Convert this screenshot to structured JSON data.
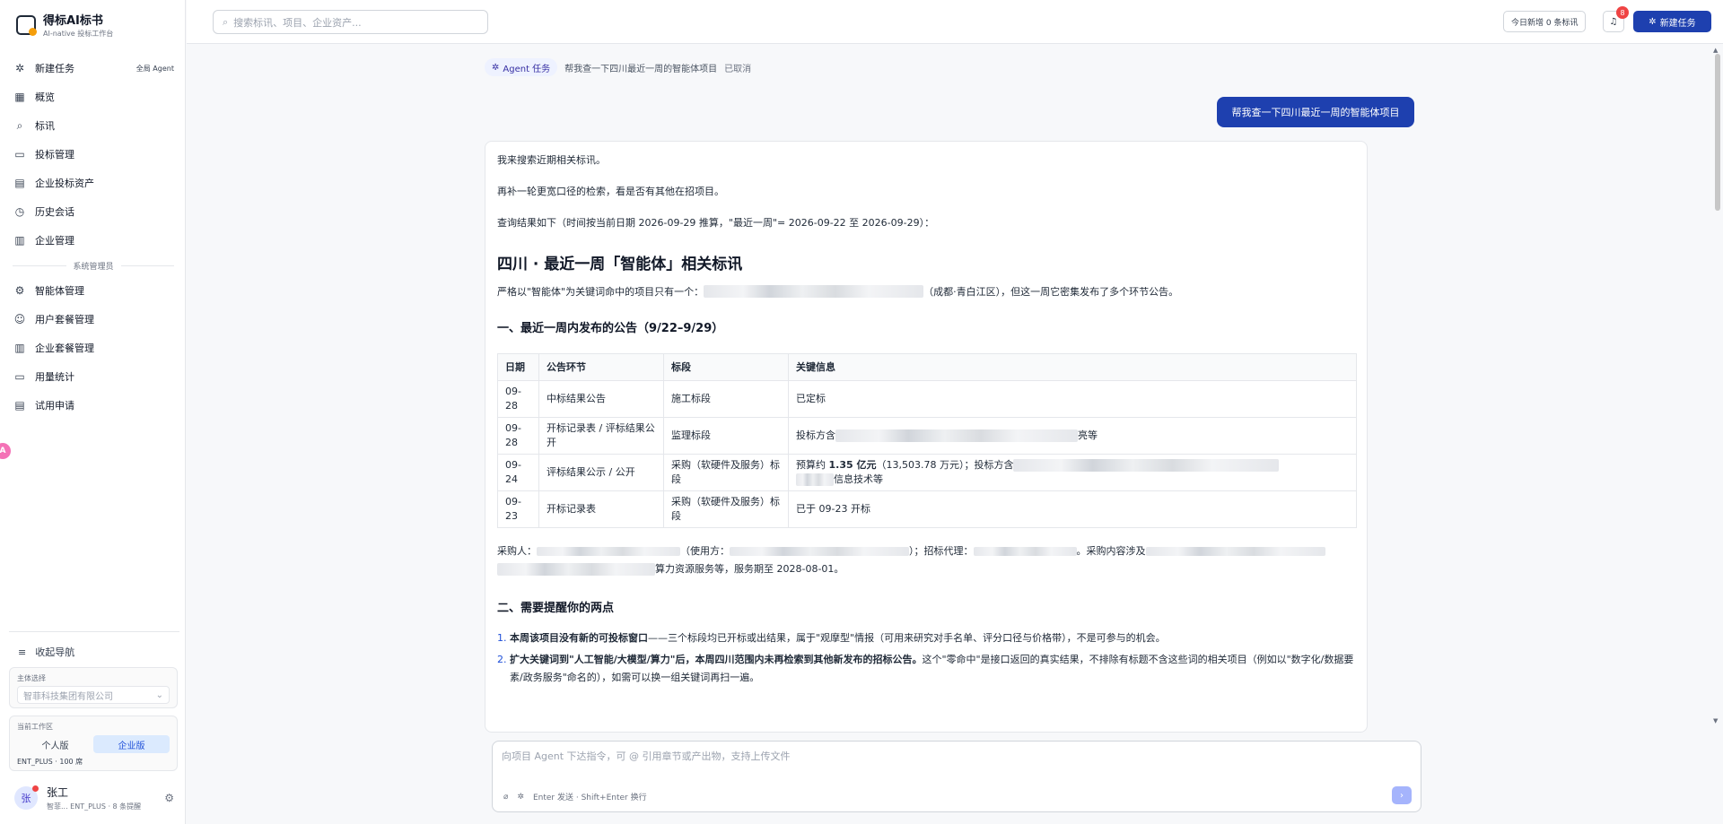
{
  "app": {
    "title": "得标AI标书",
    "subtitle": "AI-native 投标工作台"
  },
  "nav": {
    "items": [
      {
        "label": "新建任务",
        "icon": "sparkle-icon",
        "tag": "全局 Agent"
      },
      {
        "label": "概览",
        "icon": "grid-icon"
      },
      {
        "label": "标讯",
        "icon": "search-icon"
      },
      {
        "label": "投标管理",
        "icon": "folder-icon"
      },
      {
        "label": "企业投标资产",
        "icon": "asset-icon"
      },
      {
        "label": "历史会话",
        "icon": "clock-icon"
      },
      {
        "label": "企业管理",
        "icon": "building-icon"
      }
    ],
    "section_label": "系统管理员",
    "admin_items": [
      {
        "label": "智能体管理",
        "icon": "gear-icon"
      },
      {
        "label": "用户套餐管理",
        "icon": "user-icon"
      },
      {
        "label": "企业套餐管理",
        "icon": "building-icon"
      },
      {
        "label": "用量统计",
        "icon": "chart-icon"
      },
      {
        "label": "试用申请",
        "icon": "form-icon"
      }
    ],
    "collapse_label": "收起导航"
  },
  "subject": {
    "label": "主体选择",
    "value": "智菲科技集团有限公司"
  },
  "workspace": {
    "label": "当前工作区",
    "tabs": [
      "个人版",
      "企业版"
    ],
    "active": "企业版",
    "plan": "ENT_PLUS · 100 席"
  },
  "user": {
    "avatar": "张",
    "name": "张工",
    "meta": "智菲...   ENT_PLUS · 8 条提醒"
  },
  "topbar": {
    "search_placeholder": "搜索标讯、项目、企业资产...",
    "today": "今日新增 0 条标讯",
    "bell_count": "8",
    "new_task": "新建任务"
  },
  "crumb": {
    "chip": "Agent 任务",
    "text": "帮我查一下四川最近一周的智能体项目",
    "status": "已取消"
  },
  "user_message": "帮我查一下四川最近一周的智能体项目",
  "answer": {
    "p1": "我来搜索近期相关标讯。",
    "p2": "再补一轮更宽口径的检索，看是否有其他在招项目。",
    "p3": "查询结果如下（时间按当前日期 2026-09-29 推算，\"最近一周\"= 2026-09-22 至 2026-09-29）：",
    "h2": "四川 · 最近一周「智能体」相关标讯",
    "intro_pre": "严格以\"智能体\"为关键词命中的项目只有一个：",
    "intro_post": "（成都·青白江区），但这一周它密集发布了多个环节公告。",
    "h3a": "一、最近一周内发布的公告（9/22–9/29）",
    "table": {
      "headers": [
        "日期",
        "公告环节",
        "标段",
        "关键信息"
      ],
      "rows": [
        {
          "date": "09-28",
          "stage": "中标结果公告",
          "section": "施工标段",
          "info": "已定标"
        },
        {
          "date": "09-28",
          "stage": "开标记录表 / 评标结果公开",
          "section": "监理标段",
          "info_pre": "投标方含",
          "info_post": "亮等"
        },
        {
          "date": "09-24",
          "stage": "评标结果公示 / 公开",
          "section": "采购（软硬件及服务）标段",
          "info_pre": "预算约 ",
          "info_bold": "1.35 亿元",
          "info_mid": "（13,503.78 万元）；投标方含",
          "info_post": "信息技术等"
        },
        {
          "date": "09-23",
          "stage": "开标记录表",
          "section": "采购（软硬件及服务）标段",
          "info": "已于 09-23 开标"
        }
      ]
    },
    "buyer": {
      "label": "采购人：",
      "user_label": "（使用方：",
      "agent_label": "）；招标代理：",
      "content_label": "。采购内容涉及",
      "tail": "算力资源服务等，服务期至 2028-08-01。"
    },
    "h3b": "二、需要提醒你的两点",
    "notes": [
      {
        "bold": "本周该项目没有新的可投标窗口",
        "rest": "——三个标段均已开标或出结果，属于\"观摩型\"情报（可用来研究对手名单、评分口径与价格带），不是可参与的机会。"
      },
      {
        "bold": "扩大关键词到\"人工智能/大模型/算力\"后，本周四川范围内未再检索到其他新发布的招标公告。",
        "rest": "这个\"零命中\"是接口返回的真实结果，不排除有标题不含这些词的相关项目（例如以\"数字化/数据要素/政务服务\"命名的），如需可以换一组关键词再扫一遍。"
      }
    ]
  },
  "composer": {
    "placeholder": "向项目 Agent 下达指令，可 @ 引用章节或产出物，支持上传文件",
    "hint": "Enter 发送 · Shift+Enter 换行"
  }
}
